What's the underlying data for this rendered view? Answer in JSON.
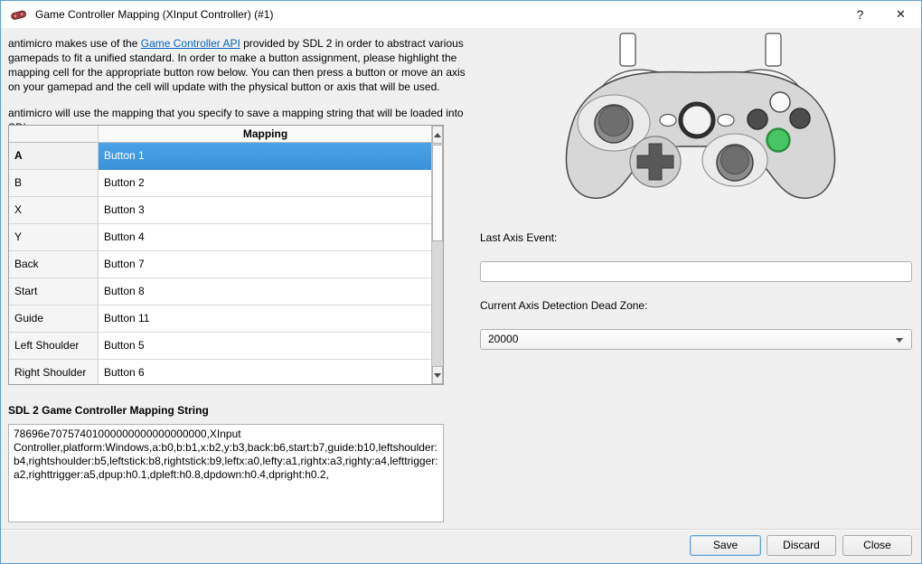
{
  "window": {
    "title": "Game Controller Mapping (XInput Controller) (#1)",
    "help_button": "?",
    "close_button": "✕"
  },
  "intro": {
    "p1_before": "antimicro makes use of the ",
    "p1_link": "Game Controller API",
    "p1_after": " provided by SDL 2 in order to abstract various gamepads to fit a unified standard. In order to make a button assignment, please highlight the mapping cell for the appropriate button row below. You can then press a button or move an axis on your gamepad and the cell will update with the physical button or axis that will be used.",
    "p2": "antimicro will use the mapping that you specify to save a mapping string that will be loaded into SDL."
  },
  "mapping_table": {
    "header": "Mapping",
    "rows": [
      {
        "button": "A",
        "mapping": "Button 1",
        "selected": true
      },
      {
        "button": "B",
        "mapping": "Button 2"
      },
      {
        "button": "X",
        "mapping": "Button 3"
      },
      {
        "button": "Y",
        "mapping": "Button 4"
      },
      {
        "button": "Back",
        "mapping": "Button 7"
      },
      {
        "button": "Start",
        "mapping": "Button 8"
      },
      {
        "button": "Guide",
        "mapping": "Button 11"
      },
      {
        "button": "Left Shoulder",
        "mapping": "Button 5"
      },
      {
        "button": "Right Shoulder",
        "mapping": "Button 6"
      }
    ]
  },
  "mapping_string": {
    "label": "SDL 2 Game Controller Mapping String",
    "value": "78696e70757401000000000000000000,XInput Controller,platform:Windows,a:b0,b:b1,x:b2,y:b3,back:b6,start:b7,guide:b10,leftshoulder:b4,rightshoulder:b5,leftstick:b8,rightstick:b9,leftx:a0,lefty:a1,rightx:a3,righty:a4,lefttrigger:a2,righttrigger:a5,dpup:h0.1,dpleft:h0.8,dpdown:h0.4,dpright:h0.2,"
  },
  "axis_panel": {
    "last_axis_label": "Last Axis Event:",
    "last_axis_value": "",
    "dead_zone_label": "Current Axis Detection Dead Zone:",
    "dead_zone_value": "20000"
  },
  "footer": {
    "save_label": "Save",
    "discard_label": "Discard",
    "close_label": "Close"
  },
  "colors": {
    "selection_blue": "#3f97dd",
    "highlight_green": "#47c463",
    "window_border_blue": "#5c9fd6",
    "link_blue": "#0563c1"
  }
}
